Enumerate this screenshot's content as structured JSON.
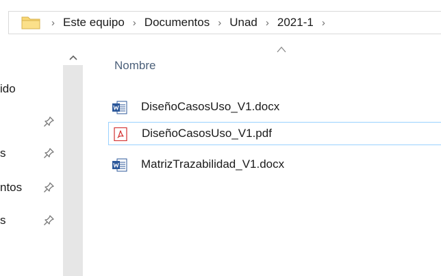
{
  "breadcrumb": {
    "items": [
      "Este equipo",
      "Documentos",
      "Unad",
      "2021-1"
    ],
    "separator": "›"
  },
  "nav": {
    "items": [
      {
        "label": "ido",
        "pinned": false
      },
      {
        "label": "",
        "pinned": true
      },
      {
        "label": "s",
        "pinned": true
      },
      {
        "label": "ntos",
        "pinned": true
      },
      {
        "label": "s",
        "pinned": true
      }
    ]
  },
  "content": {
    "column_header": "Nombre",
    "files": [
      {
        "name": "DiseñoCasosUso_V1.docx",
        "icon": "word-doc-icon",
        "selected": false
      },
      {
        "name": "DiseñoCasosUso_V1.pdf",
        "icon": "pdf-icon",
        "selected": true
      },
      {
        "name": "MatrizTrazabilidad_V1.docx",
        "icon": "word-doc-icon",
        "selected": false
      }
    ]
  },
  "colors": {
    "selection_border": "#99d1ff",
    "header_text": "#4c607a",
    "folder_yellow": "#f8d775",
    "word_blue": "#2b579a",
    "pdf_red": "#d32f2f"
  }
}
